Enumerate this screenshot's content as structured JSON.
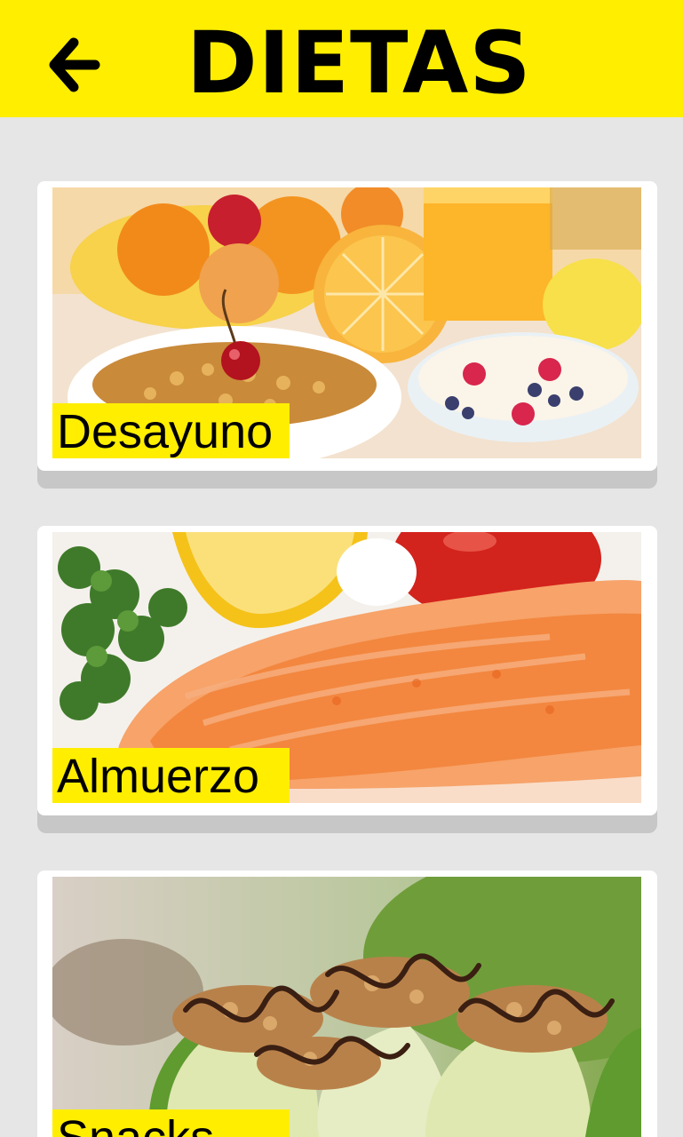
{
  "header": {
    "title": "DIETAS",
    "back_icon": "arrow-left-icon",
    "background_color": "#ffee00"
  },
  "categories": [
    {
      "label": "Desayuno",
      "image": "breakfast-fruit-cereal-yogurt-photo"
    },
    {
      "label": "Almuerzo",
      "image": "grilled-salmon-lemon-parsley-photo"
    },
    {
      "label": "Snacks",
      "image": "apple-slices-granola-chocolate-photo"
    }
  ]
}
